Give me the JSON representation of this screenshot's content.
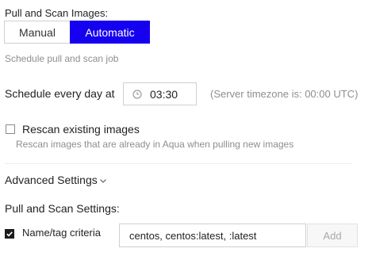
{
  "pull_scan": {
    "label": "Pull and Scan Images:",
    "options": [
      "Manual",
      "Automatic"
    ],
    "selected": "Automatic",
    "description": "Schedule pull and scan job"
  },
  "schedule": {
    "label": "Schedule every day at",
    "time_value": "03:30",
    "timezone_note": "(Server timezone is: 00:00 UTC)",
    "time_icon": "clock-icon"
  },
  "rescan": {
    "label": "Rescan existing images",
    "description": "Rescan images that are already in Aqua when pulling new images",
    "checked": false
  },
  "advanced": {
    "label": "Advanced Settings",
    "icon": "chevron-down-icon"
  },
  "pull_scan_settings": {
    "title": "Pull and Scan Settings:",
    "name_tag": {
      "label": "Name/tag criteria",
      "checked": true,
      "input_value": "centos, centos:latest, :latest",
      "add_label": "Add"
    }
  },
  "colors": {
    "accent": "#1500f0",
    "muted_text": "#8e8e8e",
    "border": "#cfcfcf"
  }
}
